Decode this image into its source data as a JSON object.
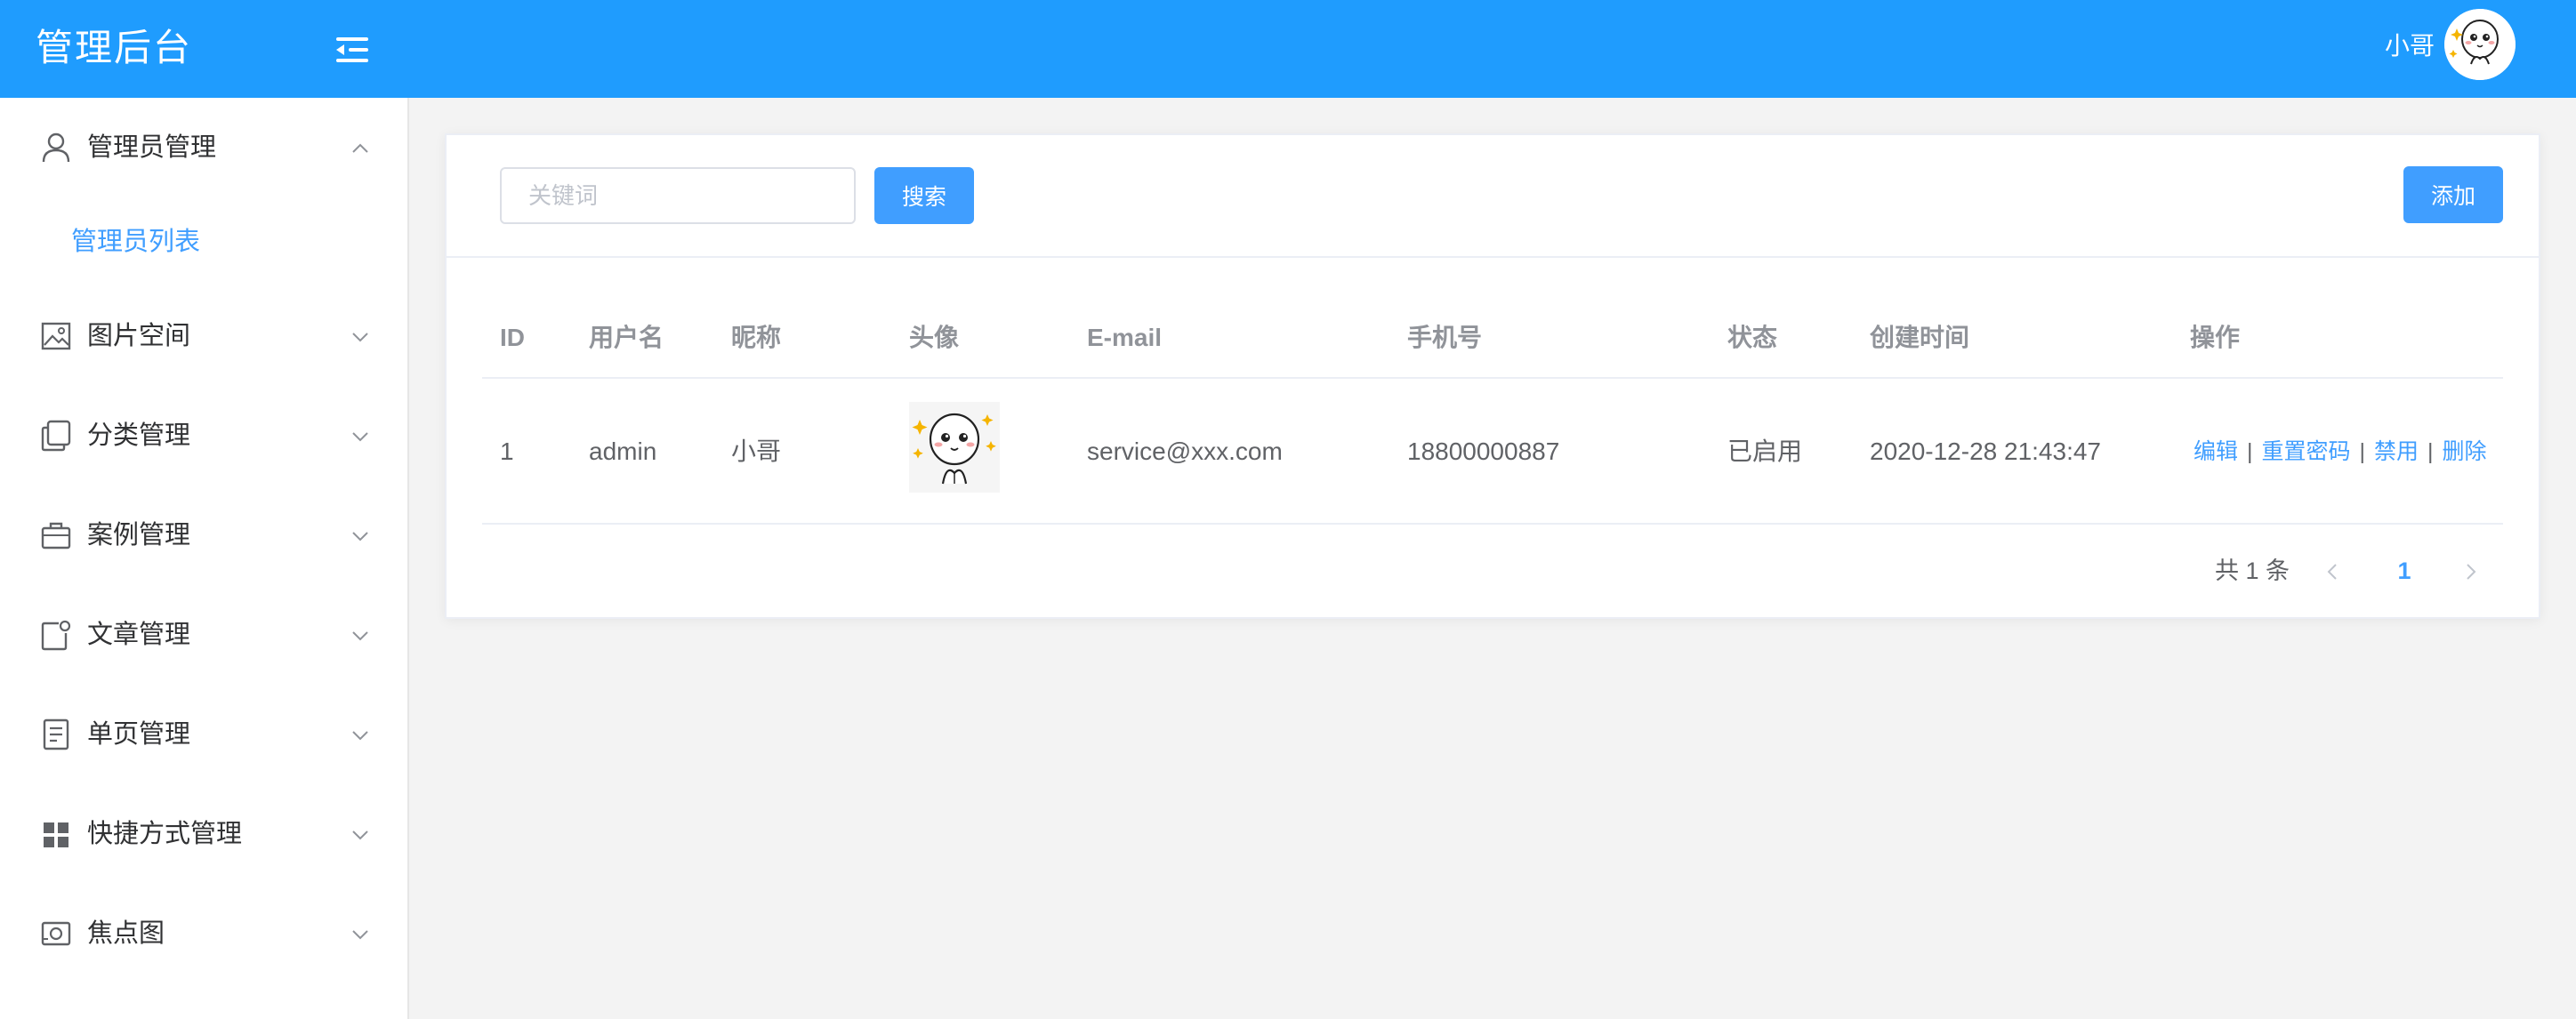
{
  "header": {
    "brand": "管理后台",
    "user_name": "小哥",
    "menu_toggle_icon": "menu-fold-icon",
    "avatar_icon": "cartoon-avatar"
  },
  "sidebar": {
    "items": [
      {
        "label": "管理员管理",
        "icon": "user-icon",
        "expanded": true
      },
      {
        "label": "图片空间",
        "icon": "picture-icon",
        "expanded": false
      },
      {
        "label": "分类管理",
        "icon": "copy-icon",
        "expanded": false
      },
      {
        "label": "案例管理",
        "icon": "briefcase-icon",
        "expanded": false
      },
      {
        "label": "文章管理",
        "icon": "article-icon",
        "expanded": false
      },
      {
        "label": "单页管理",
        "icon": "document-icon",
        "expanded": false
      },
      {
        "label": "快捷方式管理",
        "icon": "grid-icon",
        "expanded": false
      },
      {
        "label": "焦点图",
        "icon": "photo-frame-icon",
        "expanded": false
      }
    ],
    "submenu": [
      {
        "label": "管理员列表",
        "active": true
      }
    ]
  },
  "toolbar": {
    "search_placeholder": "关键词",
    "search_value": "",
    "search_label": "搜索",
    "add_label": "添加"
  },
  "table": {
    "columns": [
      "ID",
      "用户名",
      "昵称",
      "头像",
      "E-mail",
      "手机号",
      "状态",
      "创建时间",
      "操作"
    ],
    "rows": [
      {
        "id": "1",
        "username": "admin",
        "nickname": "小哥",
        "avatar": "cartoon-avatar",
        "email": "service@xxx.com",
        "phone": "18800000887",
        "status": "已启用",
        "created": "2020-12-28 21:43:47",
        "actions": [
          "编辑",
          "重置密码",
          "禁用",
          "删除"
        ]
      }
    ]
  },
  "pagination": {
    "total_text": "共 1 条",
    "current_page": "1"
  },
  "colors": {
    "header_bg": "#1f9cfe",
    "primary": "#409eff",
    "text": "#606266",
    "header_text": "#909399"
  }
}
